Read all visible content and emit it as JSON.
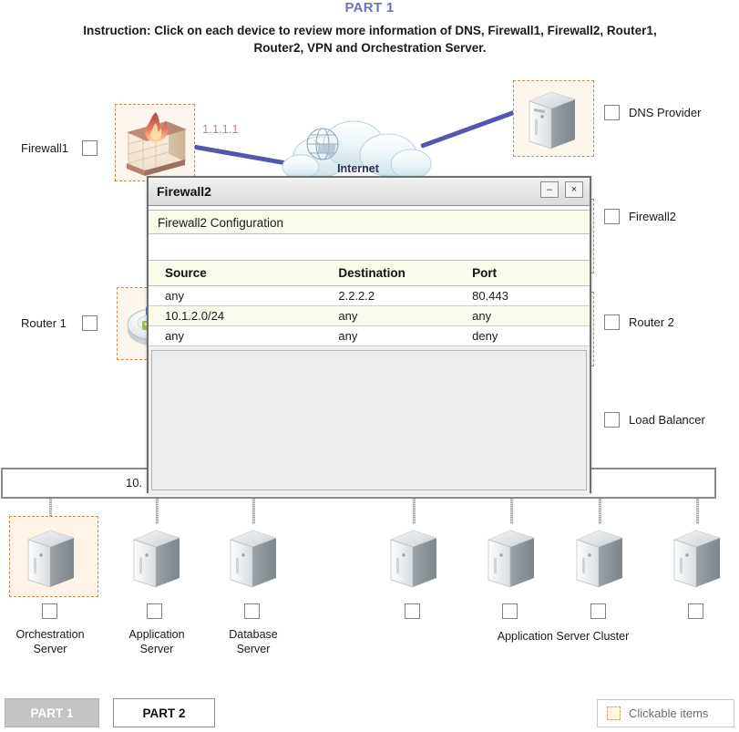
{
  "header": {
    "part_title": "PART 1",
    "instruction": "Instruction: Click on each device to review more information of DNS, Firewall1, Firewall2, Router1, Router2, VPN and Orchestration Server."
  },
  "diagram": {
    "cloud_label": "Internet",
    "firewall1_ip": "1.1.1.1",
    "lan_subnet_text": "10.",
    "left_labels": [
      {
        "label": "Firewall1"
      },
      {
        "label": "Router 1"
      }
    ],
    "right_labels": [
      {
        "label": "DNS Provider"
      },
      {
        "label": "Firewall2"
      },
      {
        "label": "Router 2"
      },
      {
        "label": "Load Balancer"
      }
    ],
    "bottom_devices": [
      {
        "label": "Orchestration\nServer",
        "line1": "Orchestration",
        "line2": "Server"
      },
      {
        "label": "Application Server",
        "line1": "Application",
        "line2": "Server"
      },
      {
        "label": "Database Server",
        "line1": "Database",
        "line2": "Server"
      }
    ],
    "cluster_label": "Application Server Cluster"
  },
  "dialog": {
    "title": "Firewall2",
    "minimize_label": "–",
    "close_label": "×",
    "config_heading": "Firewall2 Configuration",
    "table": {
      "columns": [
        "Source",
        "Destination",
        "Port"
      ],
      "rows": [
        [
          "any",
          "2.2.2.2",
          "80.443"
        ],
        [
          "10.1.2.0/24",
          "any",
          "any"
        ],
        [
          "any",
          "any",
          "deny"
        ]
      ]
    }
  },
  "footer": {
    "part1_button": "PART 1",
    "part2_button": "PART 2",
    "legend_text": "Clickable items"
  },
  "colors": {
    "title_blue": "#6e72b8",
    "link_purple": "#5456b0",
    "hotspot_border": "#c98a5e",
    "hotspot_fill": "#fdf6ec",
    "table_row_alt": "#fbfbeb",
    "ip_label": "#b08b88"
  }
}
